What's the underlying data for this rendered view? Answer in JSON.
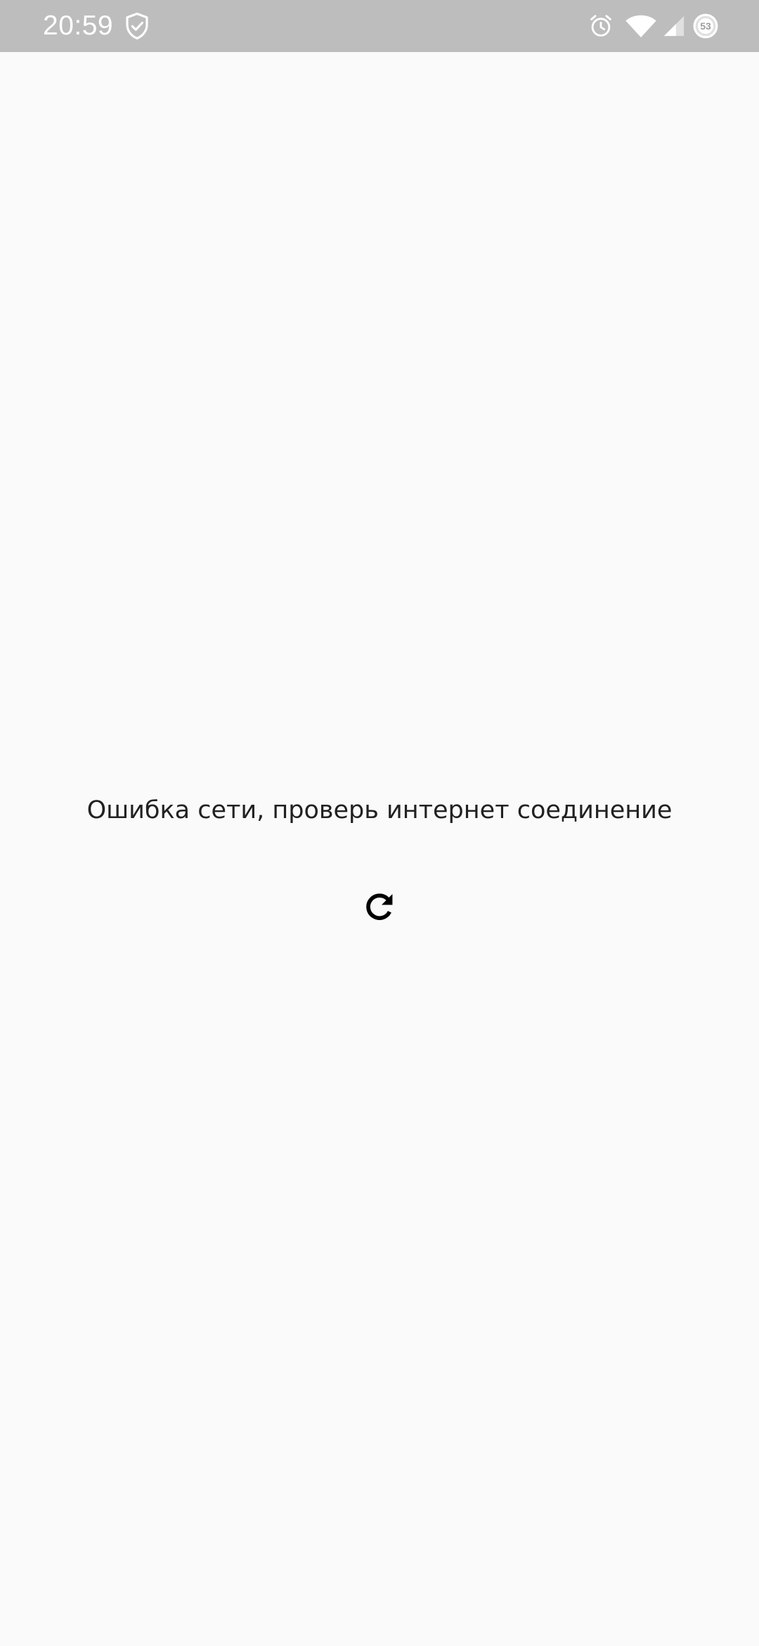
{
  "status_bar": {
    "time": "20:59",
    "battery_level": "53",
    "icons": [
      "shield-check-icon",
      "alarm-icon",
      "wifi-icon",
      "cellular-signal-icon",
      "battery-saver-icon"
    ],
    "background_color": "#bdbdbd",
    "foreground_color": "#ffffff"
  },
  "main": {
    "error_message": "Ошибка сети, проверь интернет соединение",
    "reload_icon": "refresh-icon",
    "background_color": "#fafafa",
    "text_color": "#212121"
  }
}
